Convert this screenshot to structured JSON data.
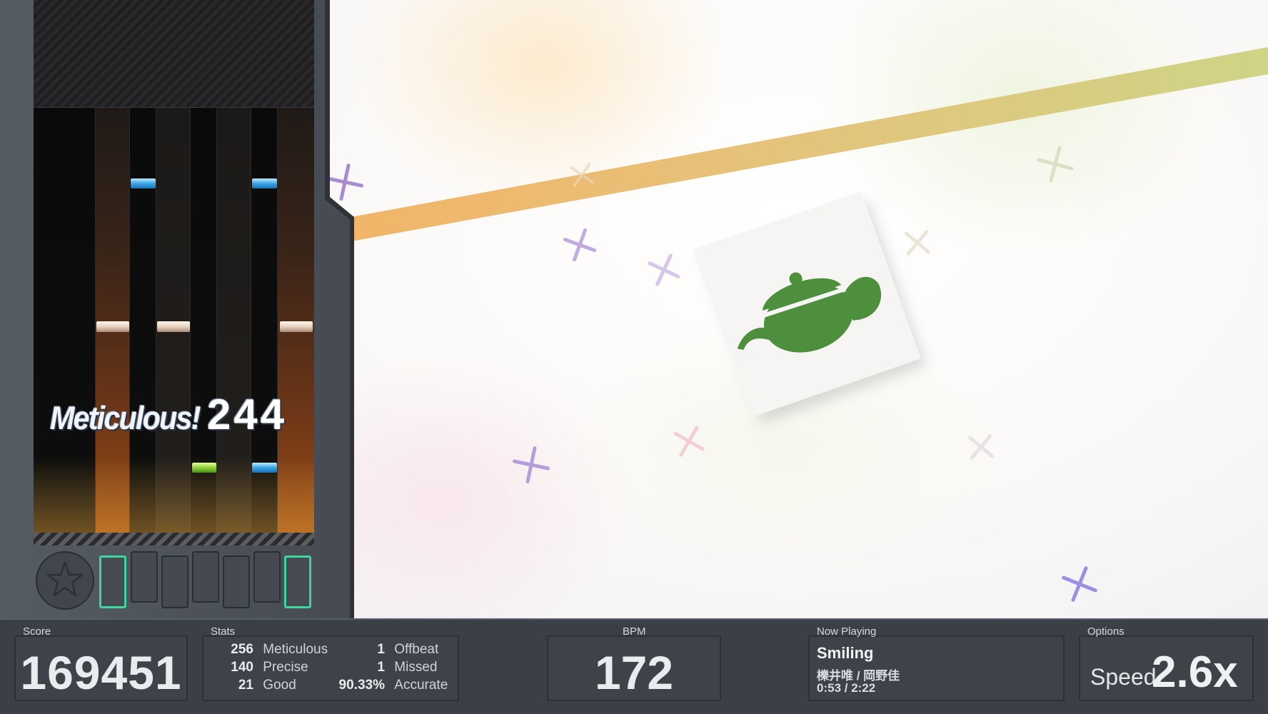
{
  "playfield": {
    "judgement": "Meticulous!",
    "combo": "244"
  },
  "colors": {
    "note_blue": "#3aa6e6",
    "note_green": "#8fd13a",
    "note_white": "#e8d2c0",
    "key_lit": "#3fd59e",
    "teapot_green": "#4e8f3e"
  },
  "album_art": {
    "icon": "teapot-icon"
  },
  "hud": {
    "score": {
      "label": "Score",
      "value": "169451"
    },
    "stats": {
      "label": "Stats",
      "meticulous": {
        "count": "256",
        "label": "Meticulous"
      },
      "precise": {
        "count": "140",
        "label": "Precise"
      },
      "good": {
        "count": "21",
        "label": "Good"
      },
      "offbeat": {
        "count": "1",
        "label": "Offbeat"
      },
      "missed": {
        "count": "1",
        "label": "Missed"
      },
      "accurate": {
        "count": "90.33%",
        "label": "Accurate"
      }
    },
    "bpm": {
      "label": "BPM",
      "value": "172"
    },
    "now_playing": {
      "label": "Now Playing",
      "title": "Smiling",
      "artist": "櫟井唯 / 岡野佳",
      "time": "0:53 / 2:22"
    },
    "options": {
      "label": "Options",
      "speed_label": "Speed",
      "speed_value": "2.6x"
    }
  }
}
